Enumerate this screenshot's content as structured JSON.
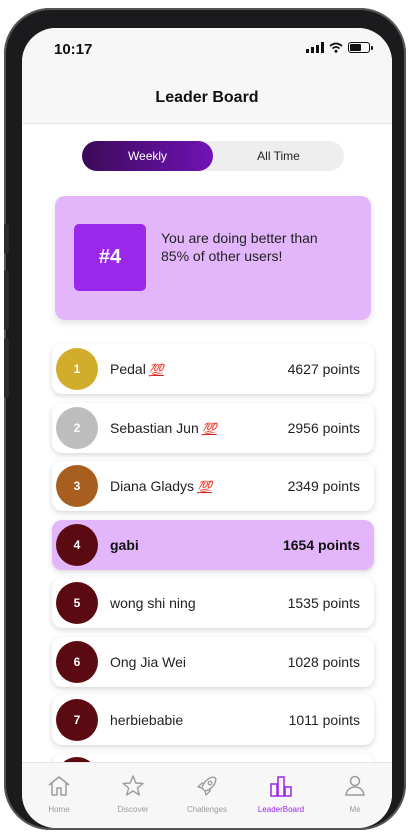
{
  "status_bar": {
    "time": "10:17"
  },
  "header": {
    "title": "Leader Board"
  },
  "segmented": {
    "weekly": "Weekly",
    "all_time": "All Time",
    "selected": "Weekly"
  },
  "rank_card": {
    "rank": "#4",
    "message": "You are doing better than 85% of other users!"
  },
  "colors": {
    "accent": "#9b27ea",
    "highlight": "#e3b6fb",
    "gold": "#d2ad2c",
    "silver": "#bdbdbd",
    "bronze": "#a85e1f",
    "maroon": "#5c0a12"
  },
  "leaderboard": [
    {
      "rank": "1",
      "name": "Pedal",
      "badge": "💯",
      "points": "4627 points",
      "color": "#d2ad2c"
    },
    {
      "rank": "2",
      "name": "Sebastian Jun",
      "badge": "💯",
      "points": "2956 points",
      "color": "#bdbdbd"
    },
    {
      "rank": "3",
      "name": "Diana Gladys",
      "badge": "💯",
      "points": "2349 points",
      "color": "#a85e1f"
    },
    {
      "rank": "4",
      "name": "gabi",
      "badge": "",
      "points": "1654 points",
      "color": "#5c0a12",
      "current_user": true
    },
    {
      "rank": "5",
      "name": "wong shi ning",
      "badge": "",
      "points": "1535 points",
      "color": "#5c0a12"
    },
    {
      "rank": "6",
      "name": "Ong Jia Wei",
      "badge": "",
      "points": "1028 points",
      "color": "#5c0a12"
    },
    {
      "rank": "7",
      "name": "herbiebabie",
      "badge": "",
      "points": "1011 points",
      "color": "#5c0a12"
    }
  ],
  "tabs": [
    {
      "label": "Home",
      "icon": "home-icon"
    },
    {
      "label": "Discover",
      "icon": "star-icon"
    },
    {
      "label": "Challenges",
      "icon": "rocket-icon"
    },
    {
      "label": "LeaderBoard",
      "icon": "leaderboard-icon",
      "active": true
    },
    {
      "label": "Me",
      "icon": "user-icon"
    }
  ]
}
